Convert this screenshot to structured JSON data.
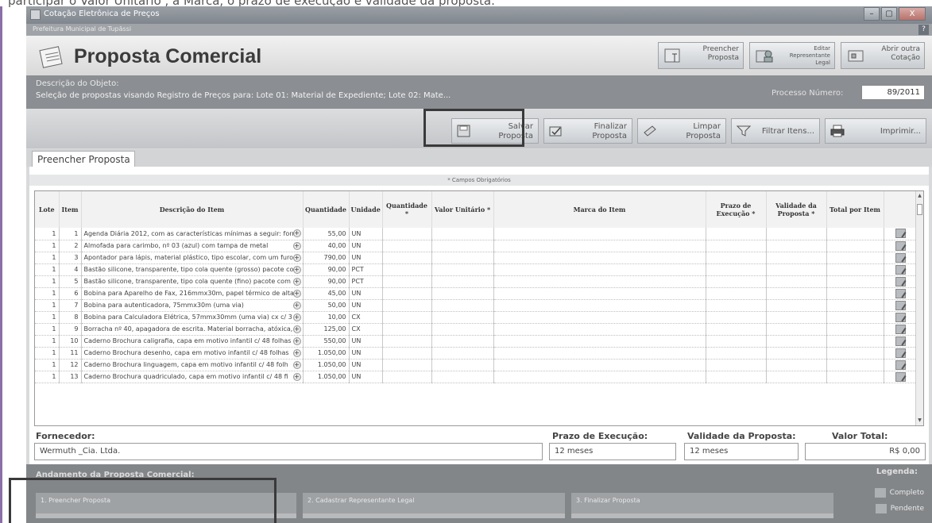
{
  "instruction_fragment": "participar o Valor Unitário , a Marca, o prazo de execução e validade da proposta.",
  "window": {
    "title": "Cotação Eletrônica de Preços",
    "subtitle": "Prefeitura Municipal de Tupãssi",
    "controls": {
      "minimize": "–",
      "maximize": "▢",
      "close": "X"
    },
    "help": "?"
  },
  "header": {
    "title": "Proposta Comercial",
    "buttons": [
      {
        "label_line1": "Preencher",
        "label_line2": "Proposta",
        "icon": "fill-proposal-icon"
      },
      {
        "label_line1": "Editar",
        "label_line2": "Representante",
        "label_line3": "Legal",
        "icon": "edit-representative-icon"
      },
      {
        "label_line1": "Abrir outra",
        "label_line2": "Cotação",
        "icon": "open-quote-icon"
      }
    ]
  },
  "object": {
    "label": "Descrição do Objeto:",
    "value": "Seleção de propostas visando Registro de Preços para: Lote 01: Material de Expediente; Lote 02: Mate...",
    "process_label": "Processo Número:",
    "process_value": "89/2011"
  },
  "toolbar": {
    "buttons": [
      {
        "label_line1": "Salvar",
        "label_line2": "Proposta",
        "icon": "save-icon"
      },
      {
        "label_line1": "Finalizar",
        "label_line2": "Proposta",
        "icon": "finalize-icon"
      },
      {
        "label_line1": "Limpar",
        "label_line2": "Proposta",
        "icon": "clear-icon"
      },
      {
        "label_line1": "Filtrar Itens...",
        "icon": "filter-icon"
      },
      {
        "label_line1": "Imprimir...",
        "icon": "print-icon"
      }
    ]
  },
  "tab": {
    "label": "Preencher Proposta"
  },
  "required_note": "* Campos Obrigatórios",
  "grid": {
    "columns": [
      "Lote",
      "Item",
      "Descrição do Item",
      "Quantidade",
      "Unidade",
      "Quantidade *",
      "Valor Unitário *",
      "Marca do Item",
      "Prazo de Execução *",
      "Validade da Proposta *",
      "Total por Item"
    ],
    "rows": [
      {
        "lote": "1",
        "item": "1",
        "descricao": "Agenda Diária 2012, com as características mínimas a seguir: form",
        "quantidade": "55,00",
        "unidade": "UN"
      },
      {
        "lote": "1",
        "item": "2",
        "descricao": "Almofada para carimbo, nº 03 (azul) com tampa de metal",
        "quantidade": "40,00",
        "unidade": "UN"
      },
      {
        "lote": "1",
        "item": "3",
        "descricao": "Apontador para lápis, material plástico, tipo escolar, com um furo",
        "quantidade": "790,00",
        "unidade": "UN"
      },
      {
        "lote": "1",
        "item": "4",
        "descricao": "Bastão silicone, transparente, tipo cola quente (grosso) pacote co",
        "quantidade": "90,00",
        "unidade": "PCT"
      },
      {
        "lote": "1",
        "item": "5",
        "descricao": "Bastão silicone, transparente, tipo cola quente (fino) pacote com",
        "quantidade": "90,00",
        "unidade": "PCT"
      },
      {
        "lote": "1",
        "item": "6",
        "descricao": "Bobina para Aparelho de Fax, 216mmx30m, papel térmico de alta",
        "quantidade": "45,00",
        "unidade": "UN"
      },
      {
        "lote": "1",
        "item": "7",
        "descricao": "Bobina para autenticadora, 75mmx30m (uma via)",
        "quantidade": "50,00",
        "unidade": "UN"
      },
      {
        "lote": "1",
        "item": "8",
        "descricao": "Bobina para Calculadora Elétrica, 57mmx30mm (uma via) cx c/ 3",
        "quantidade": "10,00",
        "unidade": "CX"
      },
      {
        "lote": "1",
        "item": "9",
        "descricao": "Borracha nº 40, apagadora de escrita. Material borracha, atóxica,",
        "quantidade": "125,00",
        "unidade": "CX"
      },
      {
        "lote": "1",
        "item": "10",
        "descricao": "Caderno Brochura caligrafia, capa em motivo infantil c/ 48 folhas",
        "quantidade": "550,00",
        "unidade": "UN"
      },
      {
        "lote": "1",
        "item": "11",
        "descricao": "Caderno Brochura desenho, capa em motivo infantil c/ 48 folhas",
        "quantidade": "1.050,00",
        "unidade": "UN"
      },
      {
        "lote": "1",
        "item": "12",
        "descricao": "Caderno Brochura linguagem, capa em motivo infantil c/ 48 folh",
        "quantidade": "1.050,00",
        "unidade": "UN"
      },
      {
        "lote": "1",
        "item": "13",
        "descricao": "Caderno Brochura quadriculado, capa em motivo infantil c/ 48 fi",
        "quantidade": "1.050,00",
        "unidade": "UN"
      }
    ]
  },
  "footer": {
    "supplier_label": "Fornecedor:",
    "supplier_value": "Wermuth _Cia. Ltda.",
    "deadline_label": "Prazo de Execução:",
    "deadline_value": "12 meses",
    "validity_label": "Validade da Proposta:",
    "validity_value": "12 meses",
    "total_label": "Valor Total:",
    "total_value": "R$ 0,00"
  },
  "progress": {
    "title": "Andamento da Proposta Comercial:",
    "steps": [
      "1. Preencher Proposta",
      "2. Cadastrar Representante Legal",
      "3. Finalizar Proposta"
    ],
    "legend_title": "Legenda:",
    "legend": [
      "Completo",
      "Pendente"
    ]
  },
  "colors": {
    "frame": "#d9dadb",
    "object_bar": "#8b8e92",
    "progress_bar": "#838689",
    "title_text": "#3b3b3b"
  }
}
